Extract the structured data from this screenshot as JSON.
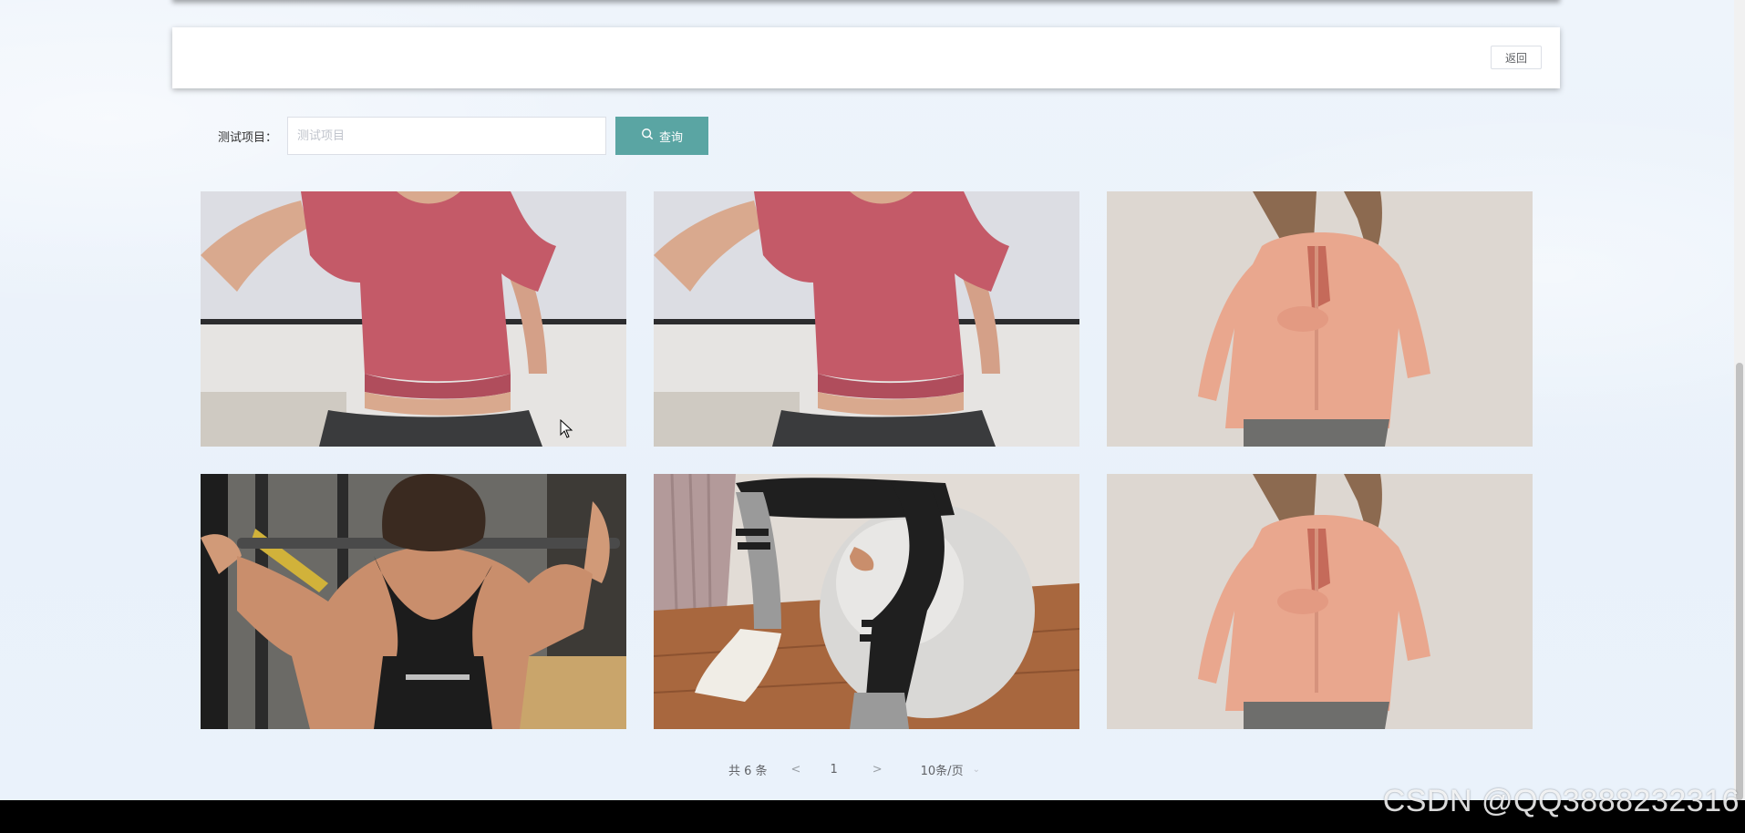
{
  "header": {
    "back_label": "返回"
  },
  "search": {
    "label": "测试项目：",
    "placeholder": "测试项目",
    "value": "",
    "button_label": "查询"
  },
  "products": [
    {
      "image": "woman in pink t-shirt",
      "alt": "pink-tshirt"
    },
    {
      "image": "woman in pink t-shirt",
      "alt": "pink-tshirt"
    },
    {
      "image": "woman in peach long-sleeve top",
      "alt": "peach-longsleeve"
    },
    {
      "image": "woman lifting barbell in black tank",
      "alt": "black-tank"
    },
    {
      "image": "legs on exercise ball with striped socks",
      "alt": "exercise-ball"
    },
    {
      "image": "woman in peach long-sleeve top",
      "alt": "peach-longsleeve"
    }
  ],
  "pagination": {
    "total_text": "共 6 条",
    "prev": "<",
    "current_page": "1",
    "next": ">",
    "page_size": "10条/页"
  },
  "watermark": "CSDN @QQ3888232316",
  "colors": {
    "accent": "#5aa5a3",
    "background": "#eaf2fb"
  }
}
